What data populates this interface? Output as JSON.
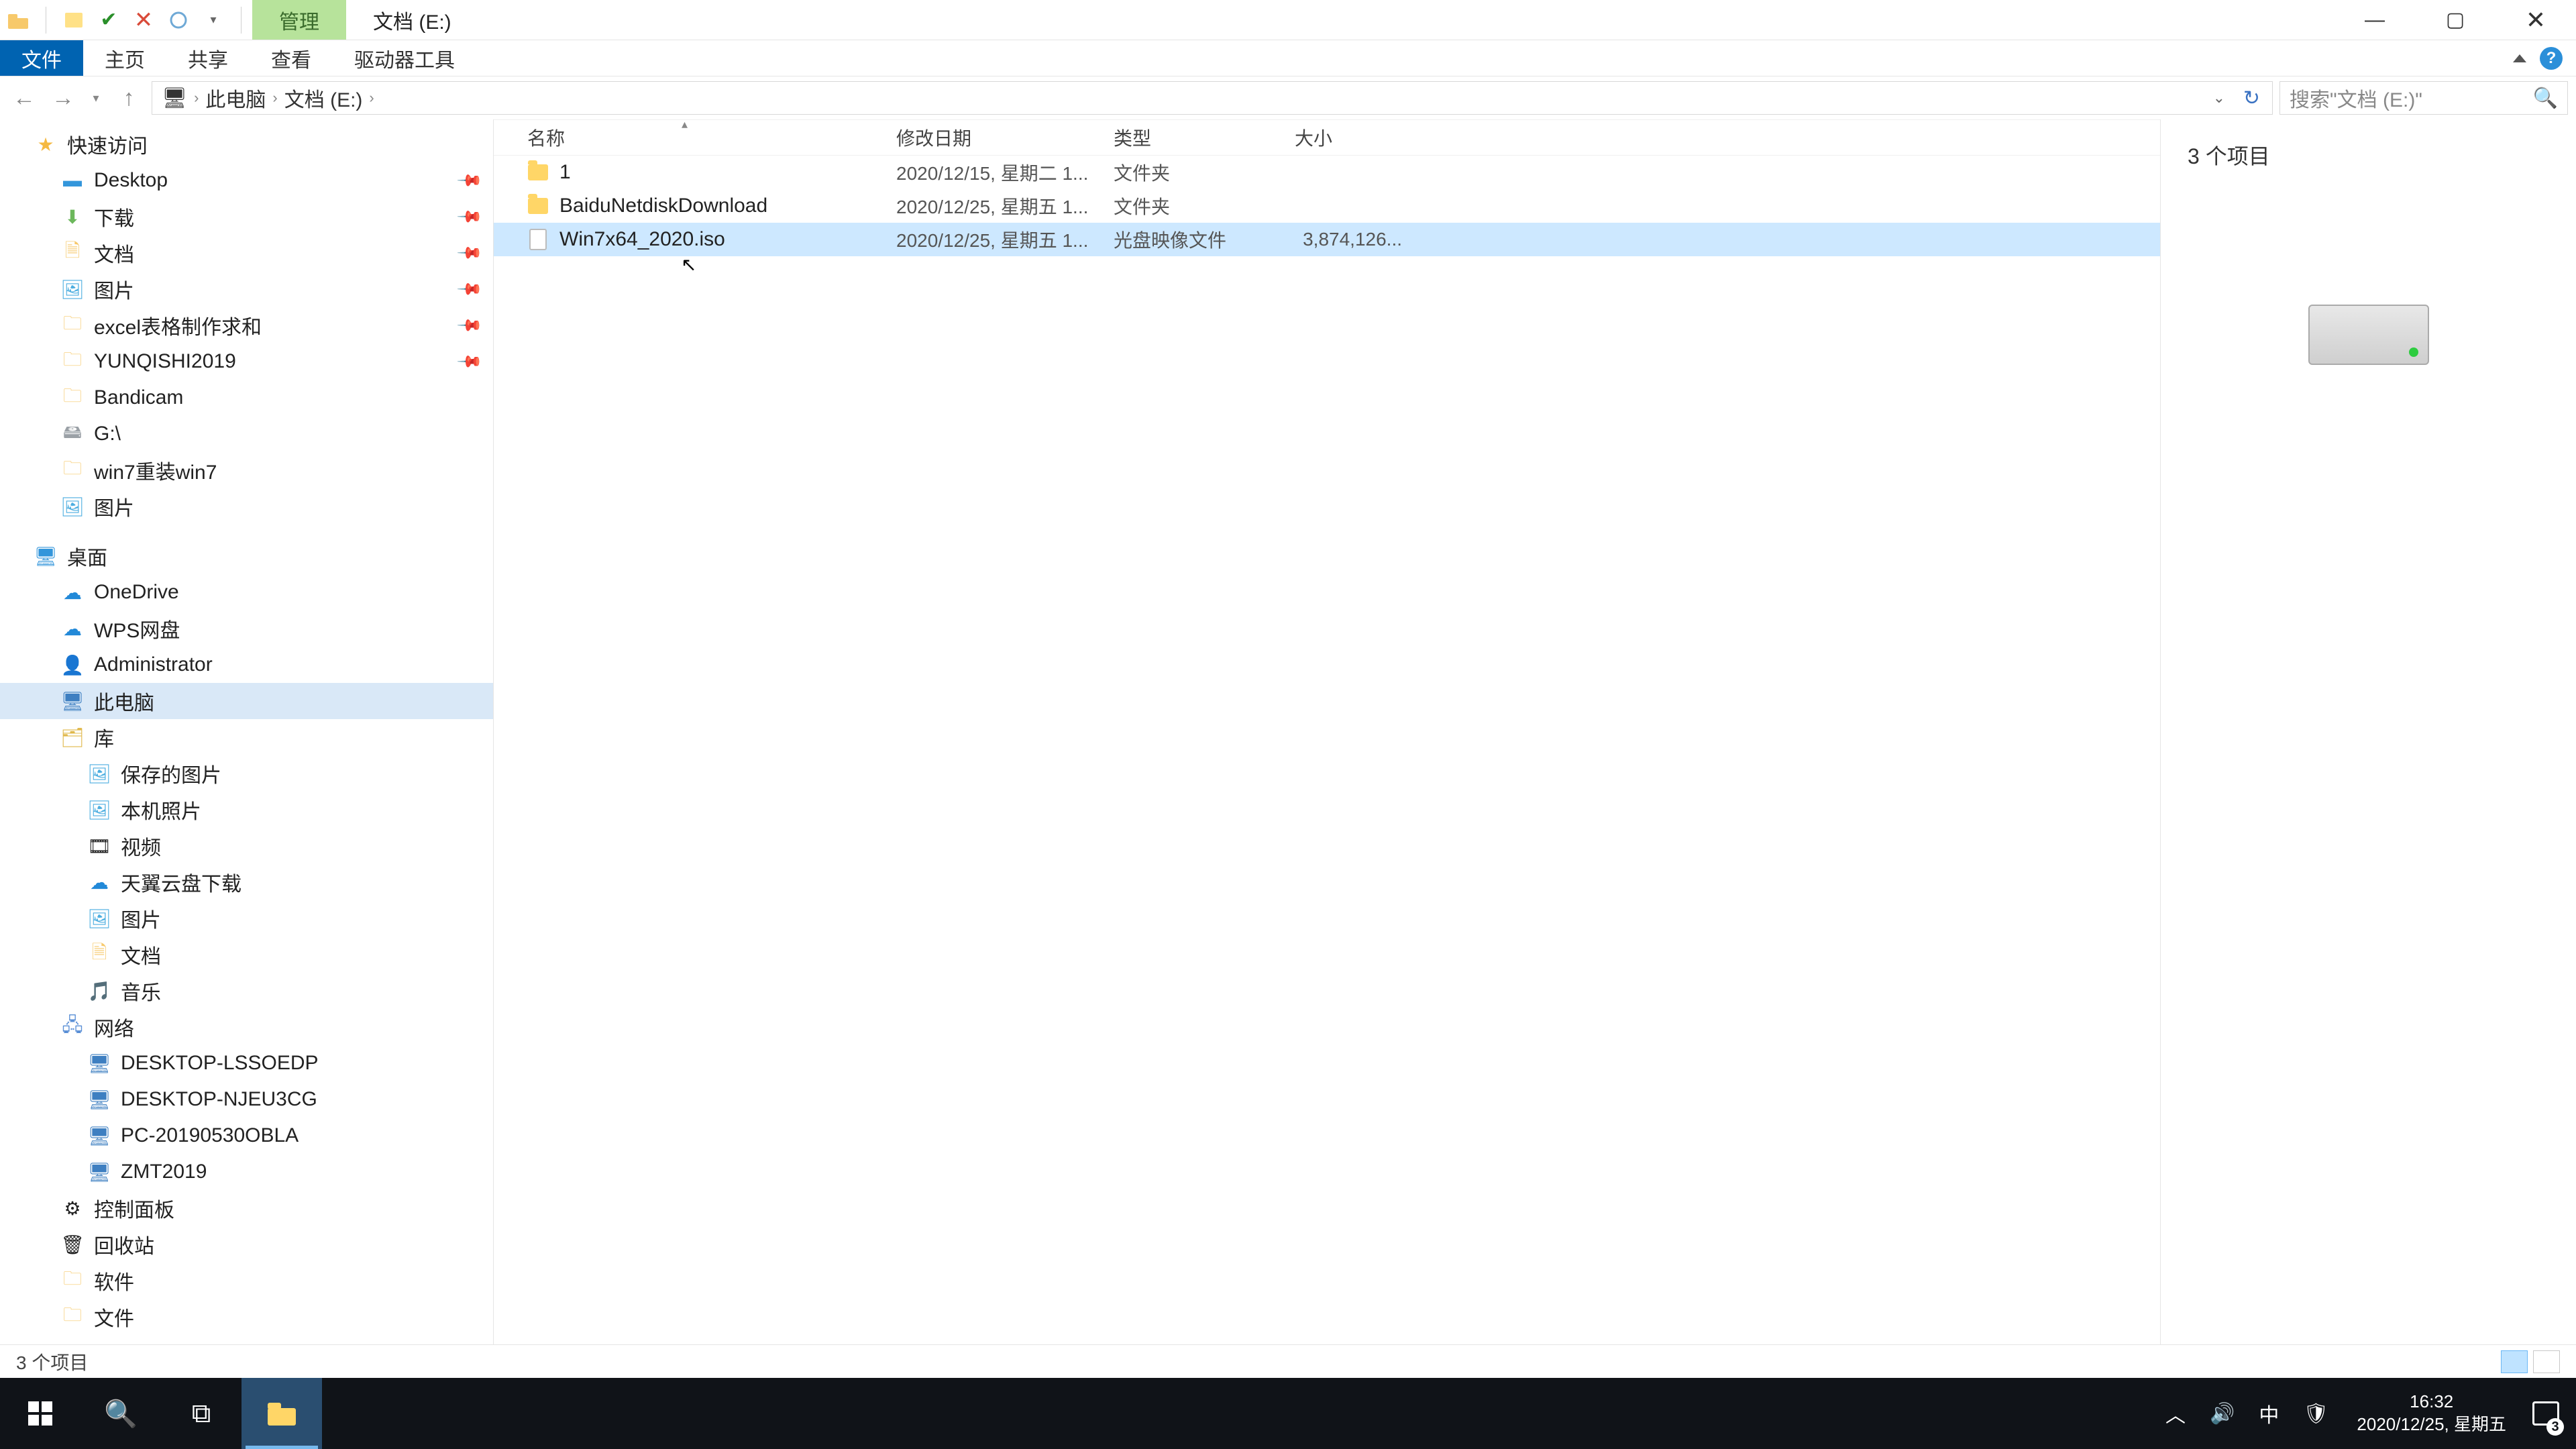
{
  "titlebar": {
    "contextual_tab": "管理",
    "window_title": "文档 (E:)"
  },
  "ribbon": {
    "file": "文件",
    "home": "主页",
    "share": "共享",
    "view": "查看",
    "drive_tools": "驱动器工具"
  },
  "address": {
    "pc": "此电脑",
    "drive": "文档 (E:)"
  },
  "search": {
    "placeholder": "搜索\"文档 (E:)\""
  },
  "columns": {
    "name": "名称",
    "date": "修改日期",
    "type": "类型",
    "size": "大小"
  },
  "files": [
    {
      "icon": "folder",
      "name": "1",
      "date": "2020/12/15, 星期二 1...",
      "type": "文件夹",
      "size": ""
    },
    {
      "icon": "folder",
      "name": "BaiduNetdiskDownload",
      "date": "2020/12/25, 星期五 1...",
      "type": "文件夹",
      "size": ""
    },
    {
      "icon": "iso",
      "name": "Win7x64_2020.iso",
      "date": "2020/12/25, 星期五 1...",
      "type": "光盘映像文件",
      "size": "3,874,126..."
    }
  ],
  "nav": {
    "quick": "快速访问",
    "quick_items": [
      {
        "icon": "blue",
        "label": "Desktop",
        "pin": true
      },
      {
        "icon": "down",
        "label": "下载",
        "pin": true
      },
      {
        "icon": "folder",
        "label": "文档",
        "pin": true
      },
      {
        "icon": "pic",
        "label": "图片",
        "pin": true
      },
      {
        "icon": "folder",
        "label": "excel表格制作求和",
        "pin": true
      },
      {
        "icon": "folder",
        "label": "YUNQISHI2019",
        "pin": true
      },
      {
        "icon": "folder",
        "label": "Bandicam",
        "pin": false
      },
      {
        "icon": "drive",
        "label": "G:\\",
        "pin": false
      },
      {
        "icon": "folder",
        "label": "win7重装win7",
        "pin": false
      },
      {
        "icon": "pic",
        "label": "图片",
        "pin": false
      }
    ],
    "desktop": "桌面",
    "desktop_items": [
      {
        "icon": "cloud",
        "label": "OneDrive"
      },
      {
        "icon": "cloud",
        "label": "WPS网盘"
      },
      {
        "icon": "user",
        "label": "Administrator"
      },
      {
        "icon": "pc",
        "label": "此电脑",
        "selected": true
      },
      {
        "icon": "lib",
        "label": "库"
      }
    ],
    "lib_items": [
      {
        "icon": "pic",
        "label": "保存的图片"
      },
      {
        "icon": "pic",
        "label": "本机照片"
      },
      {
        "icon": "vid",
        "label": "视频"
      },
      {
        "icon": "cloud",
        "label": "天翼云盘下载"
      },
      {
        "icon": "pic",
        "label": "图片"
      },
      {
        "icon": "folder",
        "label": "文档"
      },
      {
        "icon": "music",
        "label": "音乐"
      }
    ],
    "network": "网络",
    "network_items": [
      {
        "label": "DESKTOP-LSSOEDP"
      },
      {
        "label": "DESKTOP-NJEU3CG"
      },
      {
        "label": "PC-20190530OBLA"
      },
      {
        "label": "ZMT2019"
      }
    ],
    "other": [
      {
        "icon": "cp",
        "label": "控制面板"
      },
      {
        "icon": "recycle",
        "label": "回收站"
      },
      {
        "icon": "folder",
        "label": "软件"
      },
      {
        "icon": "folder",
        "label": "文件"
      }
    ]
  },
  "preview": {
    "count": "3 个项目"
  },
  "status": {
    "text": "3 个项目"
  },
  "tray": {
    "ime": "中",
    "time": "16:32",
    "date": "2020/12/25, 星期五",
    "notif_count": "3"
  }
}
